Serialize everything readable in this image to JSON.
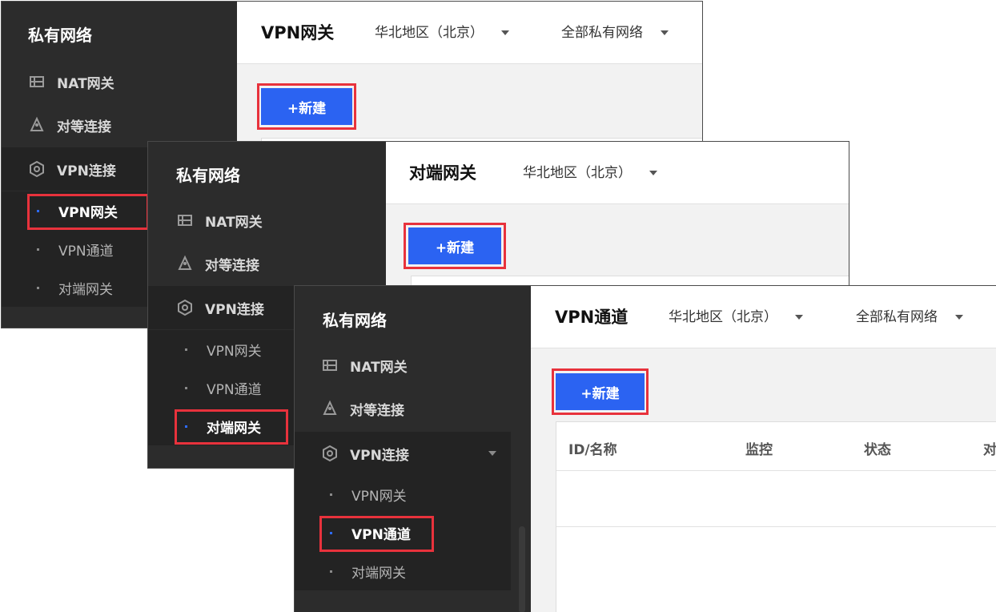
{
  "sidebar_title": "私有网络",
  "nav": {
    "nat": "NAT网关",
    "peering": "对等连接",
    "vpn": "VPN连接",
    "vpn_gateway": "VPN网关",
    "vpn_tunnel": "VPN通道",
    "peer_gateway": "对端网关"
  },
  "region": "华北地区（北京）",
  "all_vpc": "全部私有网络",
  "new_button": "+新建",
  "panel1": {
    "title": "VPN网关",
    "active_item": "VPN网关"
  },
  "panel2": {
    "title": "对端网关",
    "active_item": "对端网关"
  },
  "panel3": {
    "title": "VPN通道",
    "active_item": "VPN通道",
    "columns": [
      "ID/名称",
      "监控",
      "状态",
      "对"
    ]
  },
  "colors": {
    "sidebar": "#2c2c2c",
    "primary": "#2b63f2",
    "highlight": "#e8323c"
  }
}
